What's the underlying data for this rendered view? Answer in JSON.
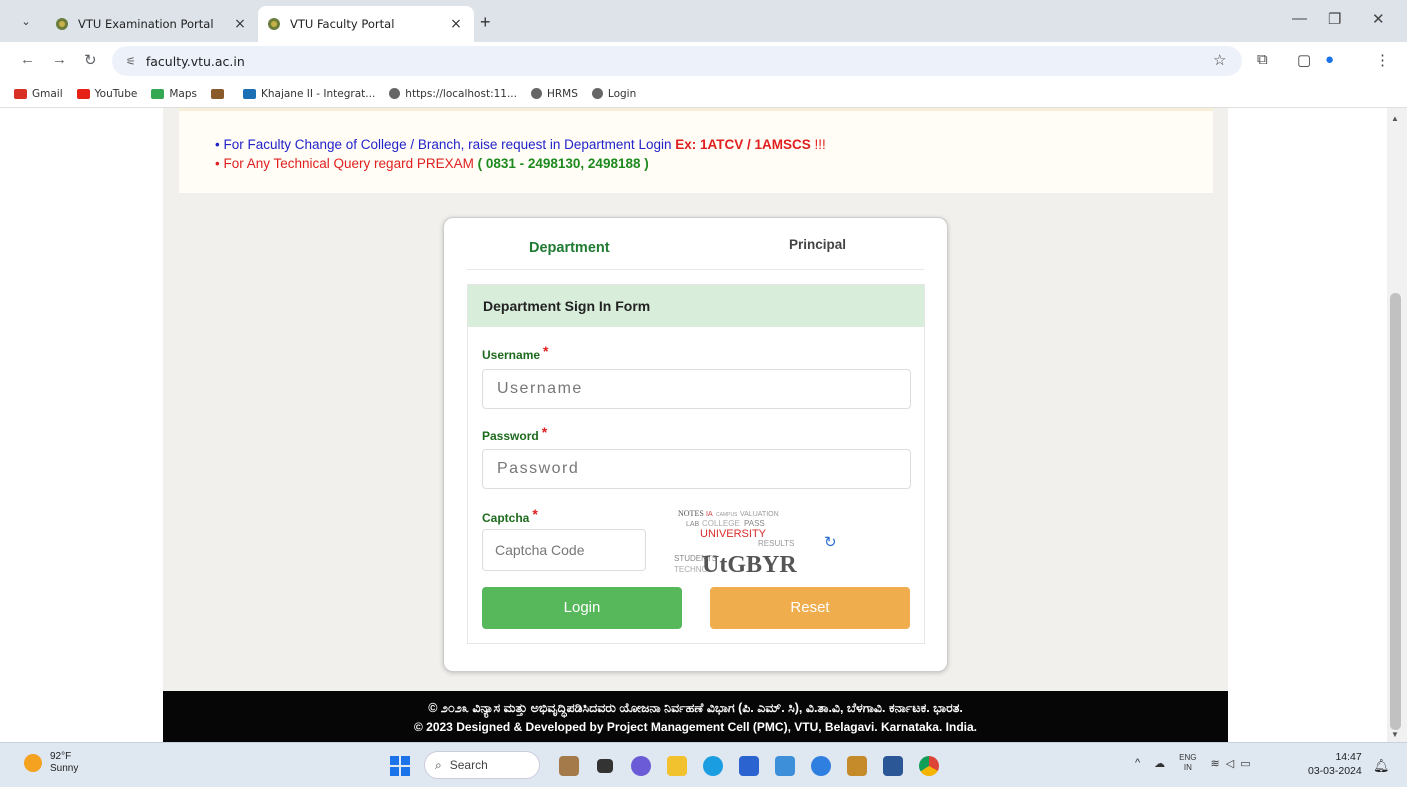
{
  "browser": {
    "tabs": [
      {
        "title": "VTU Examination Portal",
        "active": false
      },
      {
        "title": "VTU Faculty Portal",
        "active": true
      }
    ],
    "new_tab": "+",
    "url": "faculty.vtu.ac.in",
    "bookmarks": [
      "Gmail",
      "YouTube",
      "Maps",
      "",
      "Khajane II - Integrat...",
      "https://localhost:11...",
      "HRMS",
      "Login"
    ]
  },
  "notice": {
    "line1_text": "For Faculty Change of College / Branch, raise request in Department Login ",
    "line1_example": "Ex: 1ATCV / 1AMSCS",
    "line1_suffix": " !!!",
    "line2_text": "For Any Technical Query regard PREXAM ",
    "line2_phone": "( 0831 - 2498130, 2498188 )"
  },
  "login_card": {
    "tabs": [
      "Department",
      "Principal"
    ],
    "form_title": "Department Sign In Form",
    "username_label": "Username",
    "username_placeholder": "Username",
    "password_label": "Password",
    "password_placeholder": "Password",
    "captcha_label": "Captcha",
    "captcha_placeholder": "Captcha Code",
    "captcha_text": "UtGBYR",
    "captcha_words": [
      "NOTES",
      "IA",
      "CAMPUS",
      "VALUATION",
      "LAB",
      "COLLEGE",
      "PASS",
      "UNIVERSITY",
      "RESULTS",
      "STUDENTS",
      "TECHNO"
    ],
    "required_mark": "*",
    "login_label": "Login",
    "reset_label": "Reset"
  },
  "footer": {
    "line1": "© ೨೦೨೩ ವಿನ್ಯಾಸ ಮತ್ತು ಅಭಿವೃದ್ಧಿಪಡಿಸಿದವರು ಯೋಜನಾ ನಿರ್ವಹಣೆ ವಿಭಾಗ (ಪಿ. ಎಮ್. ಸಿ), ವಿ.ತಾ.ವಿ, ಬೆಳಗಾವಿ. ಕರ್ನಾಟಕ. ಭಾರತ.",
    "line2": "© 2023 Designed & Developed by Project Management Cell (PMC), VTU, Belagavi. Karnataka. India."
  },
  "taskbar": {
    "temperature": "92°F",
    "weather": "Sunny",
    "search_placeholder": "Search",
    "lang1": "ENG",
    "lang2": "IN",
    "time": "14:47",
    "date": "03-03-2024"
  },
  "colors": {
    "dept_green": "#1f7a32",
    "login_btn": "#57b75b",
    "reset_btn": "#efad4d",
    "form_header": "#d8eedb"
  }
}
